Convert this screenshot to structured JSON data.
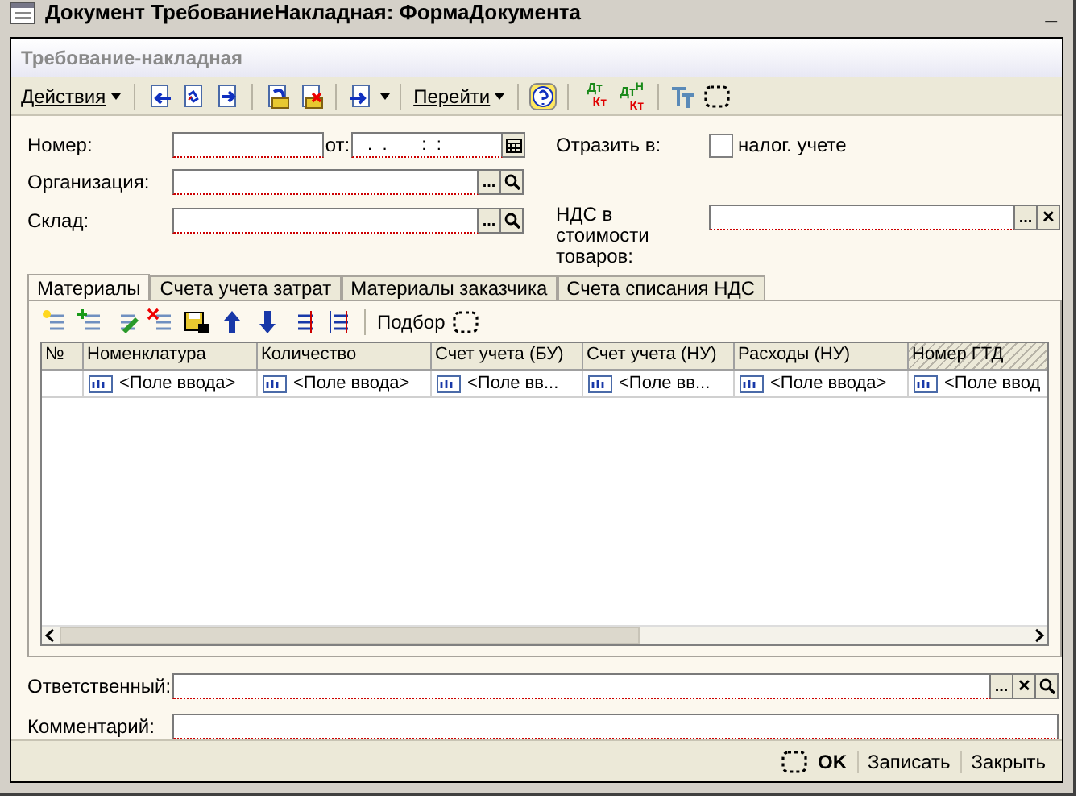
{
  "window": {
    "title": "Документ ТребованиеНакладная: ФормаДокумента",
    "minimize": "_"
  },
  "form": {
    "title": "Требование-накладная"
  },
  "toolbar": {
    "menus": [
      "Действия",
      "Перейти"
    ],
    "account_buttons": [
      {
        "top": "Дт",
        "bottom": "Кт"
      },
      {
        "top": "Дт",
        "mark": "Н",
        "bottom": "Кт"
      }
    ]
  },
  "fields": {
    "number": {
      "label": "Номер:"
    },
    "date": {
      "label": "от:",
      "value": " .  .       :  :"
    },
    "organization": {
      "label": "Организация:",
      "select": "..."
    },
    "warehouse": {
      "label": "Склад:",
      "select": "..."
    },
    "reflect": {
      "label": "Отразить в:",
      "checkbox": "налог. учете",
      "checked": false
    },
    "vat": {
      "label": "НДС в стоимости товаров:",
      "select": "...",
      "clear": "✕"
    }
  },
  "tabs": [
    {
      "label": "Материалы",
      "selected": true
    },
    {
      "label": "Счета учета затрат",
      "selected": false
    },
    {
      "label": "Материалы заказчика",
      "selected": false
    },
    {
      "label": "Счета списания НДС",
      "selected": false
    }
  ],
  "table_toolbar": {
    "label": "Подбор"
  },
  "table": {
    "columns": [
      {
        "title": "№",
        "hatched": false
      },
      {
        "title": "Номенклатура",
        "hatched": false
      },
      {
        "title": "Количество",
        "hatched": false
      },
      {
        "title": "Счет учета (БУ)",
        "hatched": false
      },
      {
        "title": "Счет учета (НУ)",
        "hatched": false
      },
      {
        "title": "Расходы (НУ)",
        "hatched": false
      },
      {
        "title": "Номер ГТД",
        "hatched": true
      }
    ],
    "rows": [
      [
        "",
        "<Поле ввода>",
        "<Поле ввода>",
        "<Поле вв...",
        "<Поле вв...",
        "<Поле ввода>",
        "<Поле ввод"
      ]
    ]
  },
  "responsible": {
    "label": "Ответственный:",
    "select": "...",
    "clear": "✕"
  },
  "comment": {
    "label": "Комментарий:"
  },
  "footer": {
    "buttons": [
      {
        "label": "OK",
        "kind": "default"
      },
      {
        "label": "Записать",
        "kind": "plain"
      },
      {
        "label": "Закрыть",
        "kind": "plain"
      }
    ]
  }
}
